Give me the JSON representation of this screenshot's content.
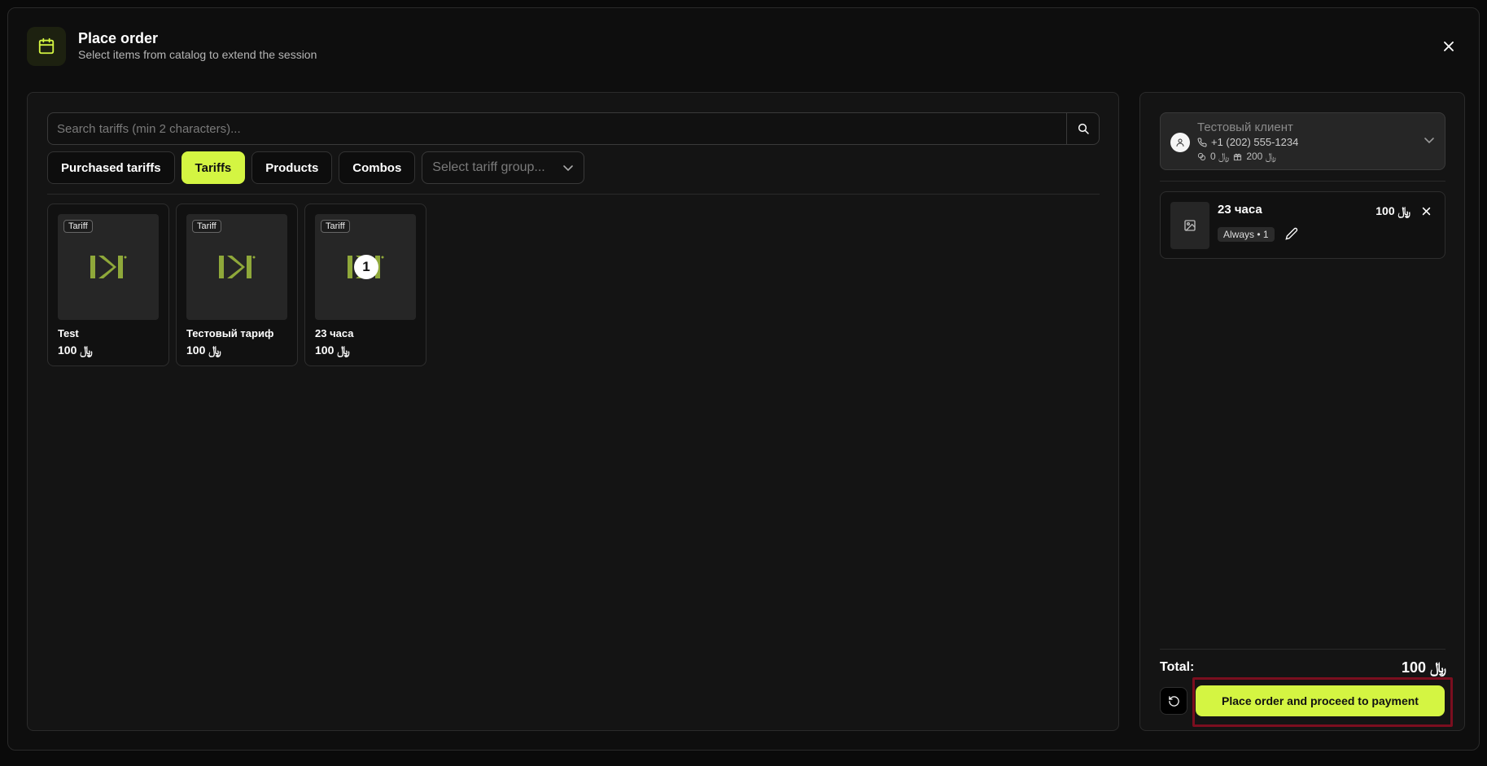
{
  "header": {
    "title": "Place order",
    "subtitle": "Select items from catalog to extend the session",
    "icon": "calendar-icon"
  },
  "search": {
    "placeholder": "Search tariffs (min 2 characters)...",
    "value": ""
  },
  "tabs": [
    {
      "label": "Purchased tariffs",
      "active": false
    },
    {
      "label": "Tariffs",
      "active": true
    },
    {
      "label": "Products",
      "active": false
    },
    {
      "label": "Combos",
      "active": false
    }
  ],
  "group_select": {
    "placeholder": "Select tariff group..."
  },
  "catalog": [
    {
      "badge": "Tariff",
      "name": "Test",
      "price": "100 ﷼",
      "qty": null
    },
    {
      "badge": "Tariff",
      "name": "Тестовый тариф",
      "price": "100 ﷼",
      "qty": null
    },
    {
      "badge": "Tariff",
      "name": "23 часа",
      "price": "100 ﷼",
      "qty": "1"
    }
  ],
  "client": {
    "name": "Тестовый клиент",
    "phone": "+1 (202) 555-1234",
    "balance": "0 ﷼",
    "bonus": "200 ﷼"
  },
  "cart": [
    {
      "name": "23 часа",
      "price": "100 ﷼",
      "tag": "Always • 1"
    }
  ],
  "summary": {
    "total_label": "Total:",
    "total_value": "100 ﷼",
    "pay_label": "Place order and proceed to payment"
  },
  "colors": {
    "accent": "#d4f542",
    "highlight_outline": "#7b0e1f"
  }
}
